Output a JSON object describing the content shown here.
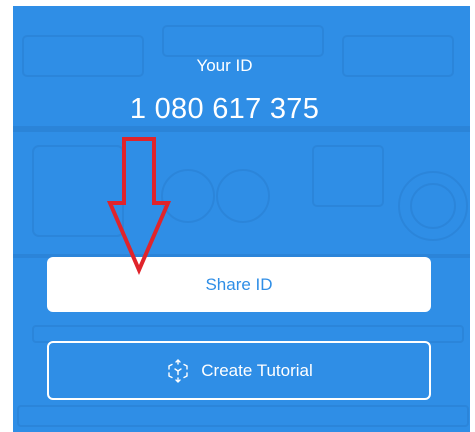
{
  "header": {
    "label": "Your ID",
    "id_value": "1 080 617 375"
  },
  "actions": {
    "share_label": "Share ID",
    "tutorial_label": "Create Tutorial"
  },
  "colors": {
    "background": "#2f8ee6",
    "button_text": "#2f8ee6",
    "annotation_arrow": "#e0242b"
  },
  "icons": {
    "tutorial": "cube-3d-icon"
  }
}
